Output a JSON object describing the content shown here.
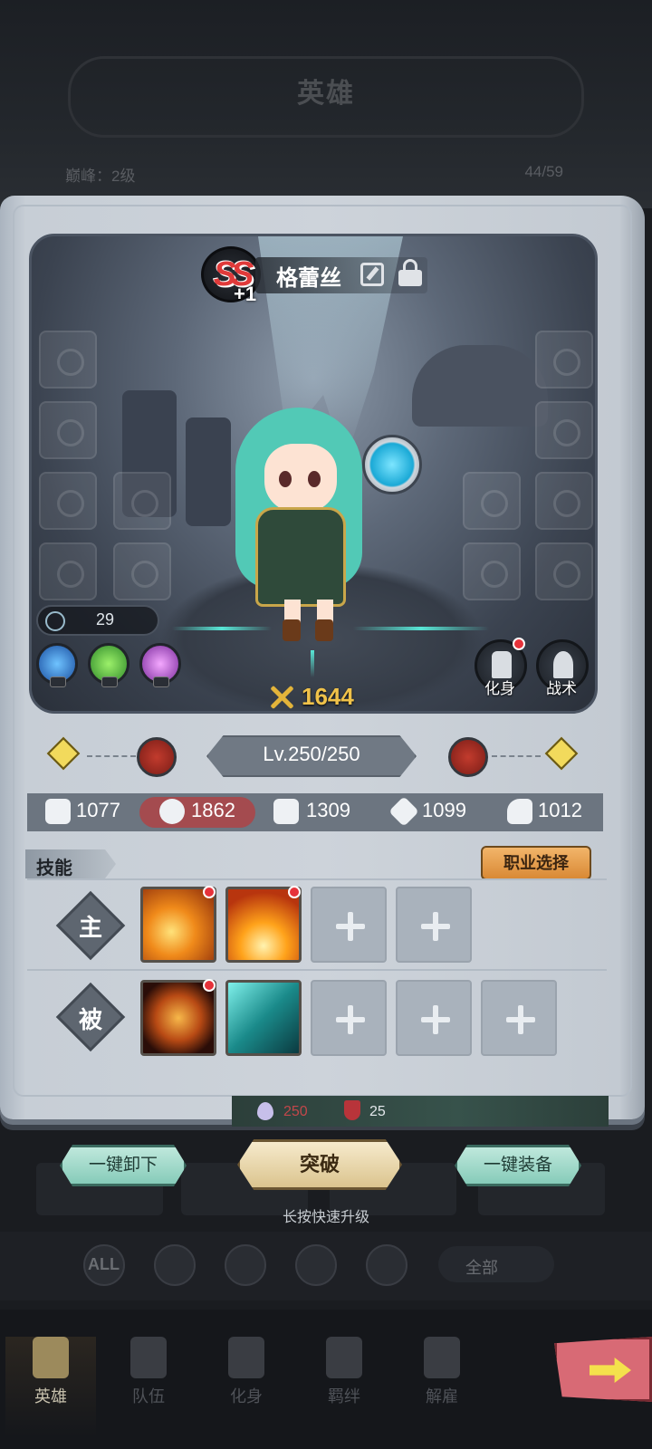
{
  "header": {
    "title": "英雄",
    "peak": "巅峰：2级",
    "count": "44/59"
  },
  "hero": {
    "rank": "SS",
    "rank_plus": "+1",
    "name": "格蕾丝",
    "soul_level": "29",
    "power": "1644",
    "level_text": "Lv.250/250",
    "buttons": {
      "avatar": "化身",
      "tactics": "战术"
    }
  },
  "stats": [
    {
      "icon": "fist-icon",
      "value": "1077"
    },
    {
      "icon": "head-icon",
      "value": "1862"
    },
    {
      "icon": "boot-icon",
      "value": "1309"
    },
    {
      "icon": "burst-icon",
      "value": "1099"
    },
    {
      "icon": "arm-icon",
      "value": "1012"
    }
  ],
  "skills": {
    "title": "技能",
    "job_select": "职业选择",
    "active_label": "主",
    "passive_label": "被"
  },
  "resources": {
    "gem": "250",
    "shield": "25"
  },
  "actions": {
    "unequip_all": "一键卸下",
    "breakthrough": "突破",
    "equip_all": "一键装备",
    "hint": "长按快速升级"
  },
  "filters": {
    "all": "ALL",
    "all_label": "全部"
  },
  "tabs": [
    {
      "label": "英雄",
      "active": true
    },
    {
      "label": "队伍"
    },
    {
      "label": "化身"
    },
    {
      "label": "羁绊"
    },
    {
      "label": "解雇"
    }
  ],
  "colors": {
    "power": "#f0c24a",
    "stat_highlight": "#a44b4f",
    "job_button": "#e49a4a",
    "red_dot": "#e6323a"
  }
}
